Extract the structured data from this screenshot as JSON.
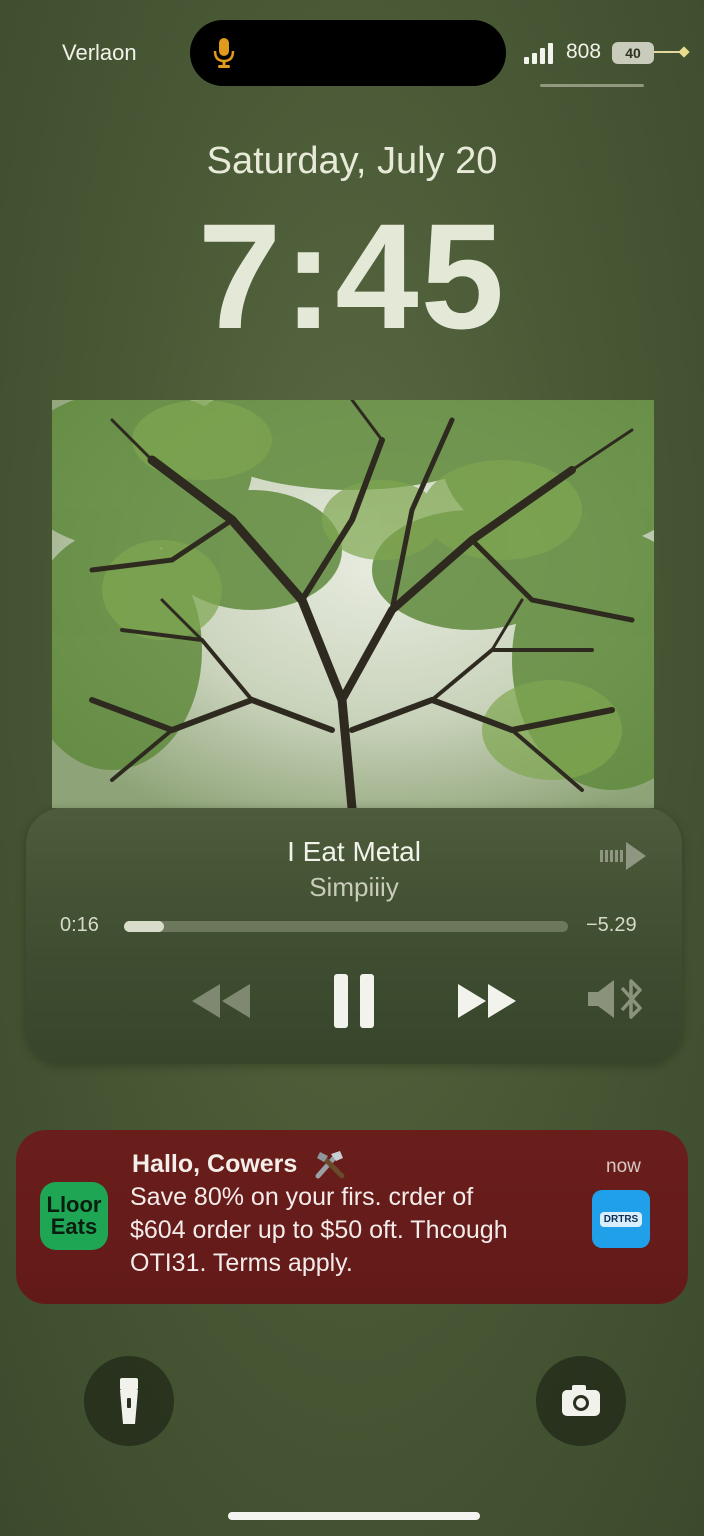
{
  "status_bar": {
    "carrier": "Verlaon",
    "network": "808",
    "battery": "40"
  },
  "lock_screen": {
    "date": "Saturday, July 20",
    "time": "7:45"
  },
  "now_playing": {
    "title": "I Eat Metal",
    "artist": "Simpiiiy",
    "elapsed": "0:16",
    "remaining": "−5.29",
    "progress_fraction": 0.09
  },
  "notification": {
    "app_icon_lines": [
      "Lloor",
      "Eats"
    ],
    "title": "Hallo, Cowers",
    "time": "now",
    "body_lines": [
      "Save 80% on your firs. crder of",
      "$604 order up to $50 oft. Thcough",
      "OTI31. Terms apply."
    ],
    "thumbnail_label": "DRTRS"
  },
  "icons": {
    "mic": "microphone-icon",
    "airplay": "airplay-icon",
    "rewind": "rewind-icon",
    "pause": "pause-icon",
    "forward": "fast-forward-icon",
    "volume": "volume-bluetooth-icon",
    "flashlight": "flashlight-icon",
    "camera": "camera-icon"
  },
  "colors": {
    "accent_mic": "#e09a1c",
    "notification_bg": "#6a1e1c",
    "app_icon_bg": "#1fa654"
  }
}
